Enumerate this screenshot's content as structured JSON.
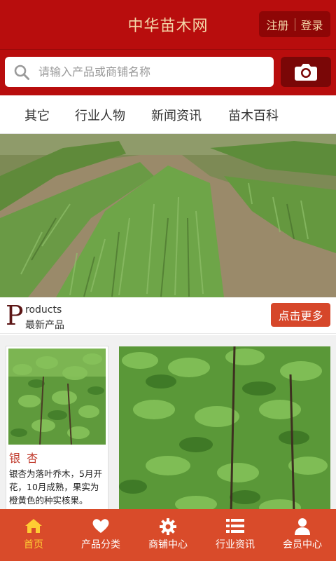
{
  "header": {
    "title": "中华苗木网",
    "register_label": "注册",
    "login_label": "登录"
  },
  "search": {
    "placeholder": "请输入产品或商铺名称",
    "search_icon": "search-icon",
    "camera_icon": "camera-icon"
  },
  "nav": {
    "items": [
      "其它",
      "行业人物",
      "新闻资讯",
      "苗木百科"
    ]
  },
  "section": {
    "letter": "P",
    "title_en": "roducts",
    "title_cn": "最新产品",
    "more_label": "点击更多"
  },
  "product": {
    "name": "银 杏",
    "description": "银杏为落叶乔木，5月开花，10月成熟，果实为橙黄色的种实核果。"
  },
  "tabbar": {
    "items": [
      {
        "label": "首页",
        "icon": "home-icon",
        "active": true
      },
      {
        "label": "产品分类",
        "icon": "heart-icon",
        "active": false
      },
      {
        "label": "商铺中心",
        "icon": "gear-icon",
        "active": false
      },
      {
        "label": "行业资讯",
        "icon": "list-icon",
        "active": false
      },
      {
        "label": "会员中心",
        "icon": "user-icon",
        "active": false
      }
    ]
  },
  "colors": {
    "header_red": "#b80d0d",
    "title_gold": "#f4d6a8",
    "tabbar_orange": "#d94b2a",
    "active_yellow": "#ffcc33"
  }
}
